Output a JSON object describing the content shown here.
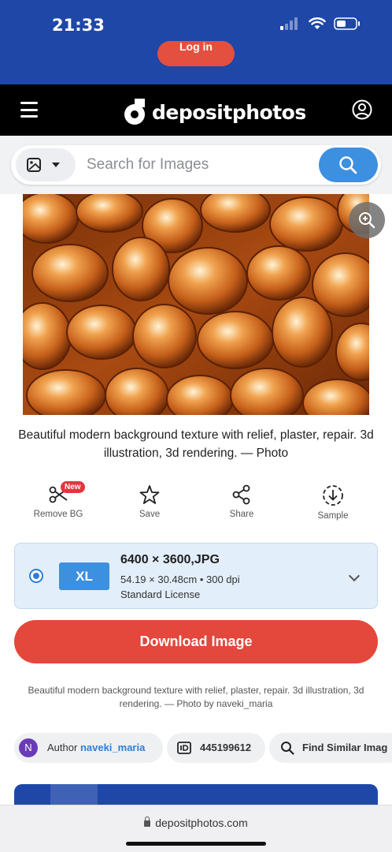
{
  "status_bar": {
    "time": "21:33"
  },
  "header": {
    "login_label": "Log in",
    "brand": "depositphotos"
  },
  "search": {
    "placeholder": "Search for Images"
  },
  "image": {
    "title": "Beautiful modern background texture with relief, plaster, repair. 3d illustration, 3d rendering. — Photo"
  },
  "actions": {
    "remove_bg": "Remove BG",
    "new_badge": "New",
    "save": "Save",
    "share": "Share",
    "sample": "Sample"
  },
  "license": {
    "size_label": "XL",
    "dimensions": "6400 × 3600,JPG",
    "print_size": "54.19 × 30.48cm • 300 dpi",
    "type": "Standard License"
  },
  "download_label": "Download Image",
  "caption": "Beautiful modern background texture with relief, plaster, repair. 3d illustration, 3d rendering. — Photo by naveki_maria",
  "meta": {
    "avatar_letter": "N",
    "author_prefix": "Author",
    "author_name": "naveki_maria",
    "image_id": "445199612",
    "find_similar": "Find Similar Imag"
  },
  "browser": {
    "url": "depositphotos.com"
  },
  "colors": {
    "brand_blue": "#1e47a8",
    "accent_blue": "#3d8fe0",
    "download_red": "#e4473b",
    "badge_red": "#e4353c"
  }
}
